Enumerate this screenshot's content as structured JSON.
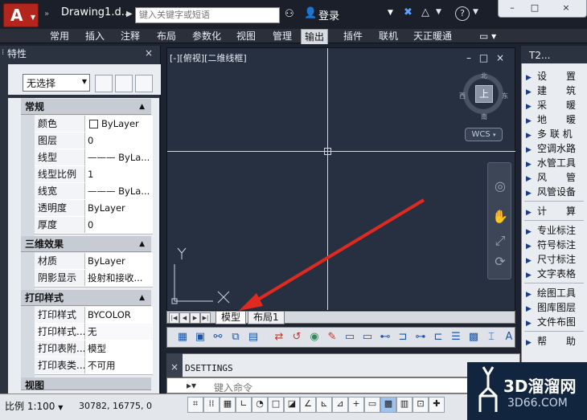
{
  "title_bar": {
    "document_title": "Drawing1.d...",
    "search_placeholder": "键入关键字或短语",
    "login_label": "登录",
    "win_minimize": "–",
    "win_restore": "□",
    "win_close": "×"
  },
  "ribbon": {
    "tabs": [
      "常用",
      "插入",
      "注释",
      "布局",
      "参数化",
      "视图",
      "管理",
      "输出",
      "插件",
      "联机",
      "天正暖通"
    ],
    "active_tab": "输出"
  },
  "properties": {
    "title": "特性",
    "selection": "无选择",
    "groups": [
      {
        "name": "常规",
        "rows": [
          {
            "name": "颜色",
            "value": "ByLayer",
            "has_swatch": true
          },
          {
            "name": "图层",
            "value": "0"
          },
          {
            "name": "线型",
            "value": "——— ByLa..."
          },
          {
            "name": "线型比例",
            "value": "1"
          },
          {
            "name": "线宽",
            "value": "——— ByLa..."
          },
          {
            "name": "透明度",
            "value": "ByLayer"
          },
          {
            "name": "厚度",
            "value": "0"
          }
        ]
      },
      {
        "name": "三维效果",
        "rows": [
          {
            "name": "材质",
            "value": "ByLayer"
          },
          {
            "name": "阴影显示",
            "value": "投射和接收..."
          }
        ]
      },
      {
        "name": "打印样式",
        "rows": [
          {
            "name": "打印样式",
            "value": "BYCOLOR"
          },
          {
            "name": "打印样式...",
            "value": "无"
          },
          {
            "name": "打印表附...",
            "value": "模型"
          },
          {
            "name": "打印表类...",
            "value": "不可用"
          }
        ]
      },
      {
        "name": "视图",
        "rows": []
      }
    ]
  },
  "viewport": {
    "label": "[-][俯视][二维线框]",
    "vp_min": "–",
    "vp_restore": "□",
    "vp_close": "×",
    "viewcube_face": "上",
    "compass": {
      "n": "北",
      "s": "南",
      "e": "东",
      "w": "西"
    },
    "wcs": "WCS",
    "axis_y": "Y",
    "axis_x": "X"
  },
  "layout_tabs": [
    "模型",
    "布局1"
  ],
  "active_layout": "模型",
  "command": {
    "history_line": "DSETTINGS",
    "placeholder": "键入命令"
  },
  "right_palette": {
    "title": "T2...",
    "items": [
      "设　　置",
      "建　　筑",
      "采　　暖",
      "地　　暖",
      "多 联 机",
      "空调水路",
      "水管工具",
      "风　　管",
      "风管设备",
      "计　　算",
      "专业标注",
      "符号标注",
      "尺寸标注",
      "文字表格",
      "绘图工具",
      "图库图层",
      "文件布图",
      "帮　　助"
    ]
  },
  "status_bar": {
    "scale": "比例 1:100",
    "coords": "30782, 16775, 0"
  },
  "watermark": {
    "title": "3D溜溜网",
    "url": "3D66.COM"
  },
  "colors": {
    "arrow": "#e02a1f",
    "canvas": "#263040",
    "ui_dark": "#2c3340"
  }
}
